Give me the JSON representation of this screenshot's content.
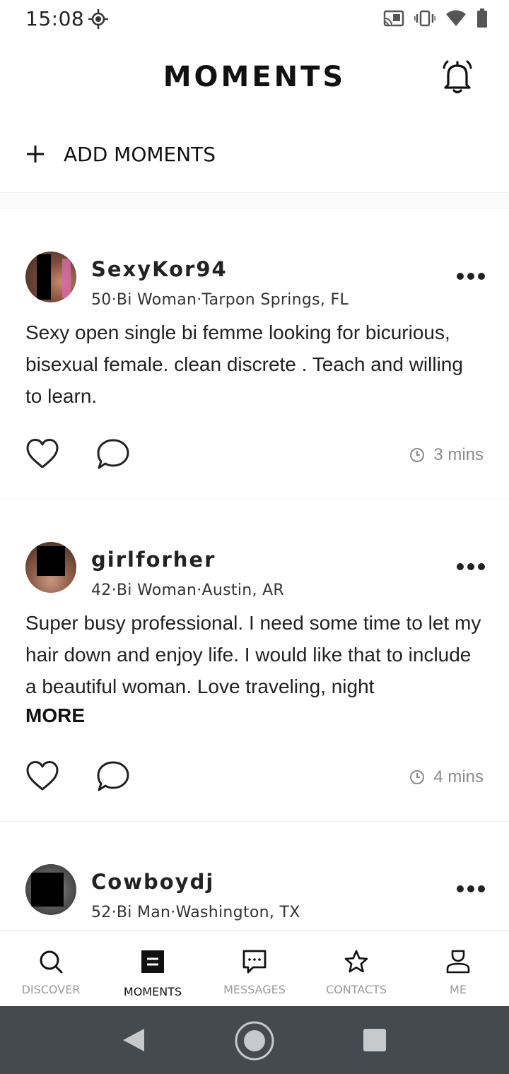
{
  "status_bar": {
    "time": "15:08"
  },
  "header": {
    "title": "MOMENTS"
  },
  "add_moments": {
    "label": "ADD MOMENTS"
  },
  "posts": [
    {
      "username": "SexyKor94",
      "meta": "50·Bi Woman·Tarpon Springs, FL",
      "text": "Sexy open single bi femme looking for bicurious, bisexual female. clean discrete . Teach and willing to learn.",
      "more": "",
      "time": "3 mins"
    },
    {
      "username": "girlforher",
      "meta": "42·Bi Woman·Austin, AR",
      "text": "Super busy professional. I need some time to let my hair down and enjoy life. I would like that to include a beautiful woman. Love traveling, night",
      "more": "MORE",
      "time": "4 mins"
    },
    {
      "username": "Cowboydj",
      "meta": "52·Bi Man·Washington, TX",
      "text": "",
      "more": "",
      "time": ""
    }
  ],
  "bottom_nav": {
    "items": [
      {
        "label": "DISCOVER",
        "icon": "search-icon",
        "active": false
      },
      {
        "label": "MOMENTS",
        "icon": "moments-icon",
        "active": true
      },
      {
        "label": "MESSAGES",
        "icon": "chat-bubble-icon",
        "active": false
      },
      {
        "label": "CONTACTS",
        "icon": "star-icon",
        "active": false
      },
      {
        "label": "ME",
        "icon": "profile-icon",
        "active": false
      }
    ]
  },
  "colors": {
    "text": "#111111",
    "muted": "#8a8a8a",
    "system_nav": "#454a50"
  }
}
